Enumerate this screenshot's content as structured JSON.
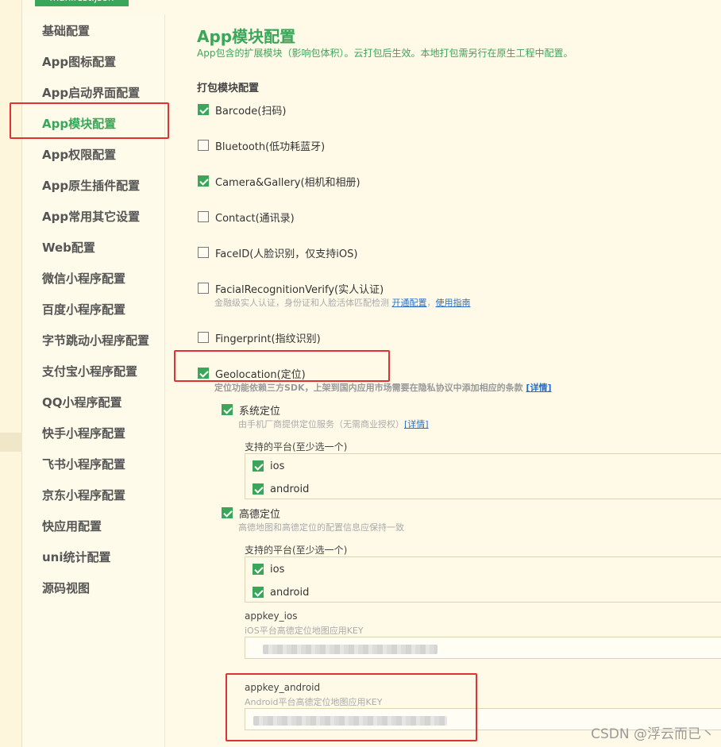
{
  "top_tab": "manifest.json",
  "sidebar": {
    "items": [
      {
        "label": "基础配置"
      },
      {
        "label": "App图标配置"
      },
      {
        "label": "App启动界面配置"
      },
      {
        "label": "App模块配置"
      },
      {
        "label": "App权限配置"
      },
      {
        "label": "App原生插件配置"
      },
      {
        "label": "App常用其它设置"
      },
      {
        "label": "Web配置"
      },
      {
        "label": "微信小程序配置"
      },
      {
        "label": "百度小程序配置"
      },
      {
        "label": "字节跳动小程序配置"
      },
      {
        "label": "支付宝小程序配置"
      },
      {
        "label": "QQ小程序配置"
      },
      {
        "label": "快手小程序配置"
      },
      {
        "label": "飞书小程序配置"
      },
      {
        "label": "京东小程序配置"
      },
      {
        "label": "快应用配置"
      },
      {
        "label": "uni统计配置"
      },
      {
        "label": "源码视图"
      }
    ],
    "active_index": 3
  },
  "main": {
    "title": "App模块配置",
    "subtitle": "App包含的扩展模块（影响包体积）。云打包后生效。本地打包需另行在原生工程中配置。",
    "section_title": "打包模块配置",
    "modules": [
      {
        "label": "Barcode(扫码)",
        "checked": true
      },
      {
        "label": "Bluetooth(低功耗蓝牙)",
        "checked": false
      },
      {
        "label": "Camera&Gallery(相机和相册)",
        "checked": true
      },
      {
        "label": "Contact(通讯录)",
        "checked": false
      },
      {
        "label": "FaceID(人脸识别，仅支持iOS)",
        "checked": false
      },
      {
        "label": "FacialRecognitionVerify(实人认证)",
        "checked": false
      },
      {
        "label": "Fingerprint(指纹识别)",
        "checked": false
      },
      {
        "label": "Geolocation(定位)",
        "checked": true
      }
    ],
    "facial_desc": "金融级实人认证，身份证和人脸活体匹配检测",
    "facial_link_open": "开通配置",
    "facial_sep": "，",
    "facial_link_guide": "使用指南",
    "geo_desc": "定位功能依赖三方SDK，上架到国内应用市场需要在隐私协议中添加相应的条款",
    "geo_link": "[详情]",
    "system_location": {
      "label": "系统定位",
      "checked": true,
      "desc": "由手机厂商提供定位服务（无需商业授权）",
      "link": "[详情]",
      "platform_label": "支持的平台(至少选一个)",
      "platforms": [
        {
          "label": "ios",
          "checked": true
        },
        {
          "label": "android",
          "checked": true
        }
      ]
    },
    "amap_location": {
      "label": "高德定位",
      "checked": true,
      "desc": "高德地图和高德定位的配置信息应保持一致",
      "platform_label": "支持的平台(至少选一个)",
      "platforms": [
        {
          "label": "ios",
          "checked": true
        },
        {
          "label": "android",
          "checked": true
        }
      ],
      "appkey_ios": {
        "label": "appkey_ios",
        "hint": "iOS平台高德定位地图应用KEY"
      },
      "appkey_android": {
        "label": "appkey_android",
        "hint": "Android平台高德定位地图应用KEY"
      }
    }
  },
  "watermark": "CSDN @浮云而已丶",
  "colors": {
    "accent": "#3aa65a",
    "highlight": "#e23131",
    "link": "#2a6fc9",
    "background": "#fffae8"
  }
}
